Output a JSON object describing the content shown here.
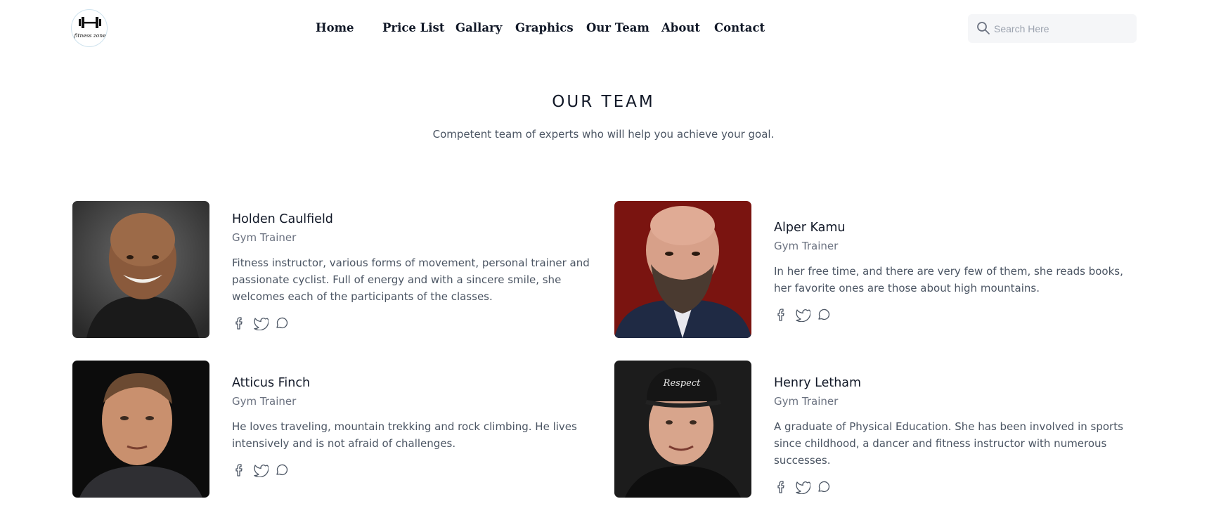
{
  "brand": {
    "logo_text": "fitness zone"
  },
  "nav": {
    "items": [
      {
        "label": "Home"
      },
      {
        "label": "Price List"
      },
      {
        "label": "Gallary"
      },
      {
        "label": "Graphics"
      },
      {
        "label": "Our Team"
      },
      {
        "label": "About"
      },
      {
        "label": "Contact"
      }
    ]
  },
  "search": {
    "placeholder": "Search Here",
    "value": ""
  },
  "section": {
    "title": "OUR TEAM",
    "subtitle": "Competent team of experts who will help you achieve your goal."
  },
  "team": [
    {
      "name": "Holden Caulfield",
      "role": "Gym Trainer",
      "bio": "Fitness instructor, various forms of movement, personal trainer and passionate cyclist. Full of energy and with a sincere smile, she welcomes each of the participants of the classes.",
      "photo_icon": "bald-smiling-man-photo"
    },
    {
      "name": "Alper Kamu",
      "role": "Gym Trainer",
      "bio": "In her free time, and there are very few of them, she reads books, her favorite ones are those about high mountains.",
      "photo_icon": "bearded-man-in-suit-photo"
    },
    {
      "name": "Atticus Finch",
      "role": "Gym Trainer",
      "bio": "He loves traveling, mountain trekking and rock climbing. He lives intensively and is not afraid of challenges.",
      "photo_icon": "short-haired-man-photo"
    },
    {
      "name": "Henry Letham",
      "role": "Gym Trainer",
      "bio": "A graduate of Physical Education. She has been involved in sports since childhood, a dancer and fitness instructor with numerous successes.",
      "photo_icon": "man-in-cap-photo"
    }
  ],
  "socials": [
    "facebook-icon",
    "twitter-icon",
    "chat-icon"
  ],
  "colors": {
    "text": "#111827",
    "muted": "#6b7280",
    "body": "#4b5563",
    "search_bg": "#f5f6f8"
  }
}
